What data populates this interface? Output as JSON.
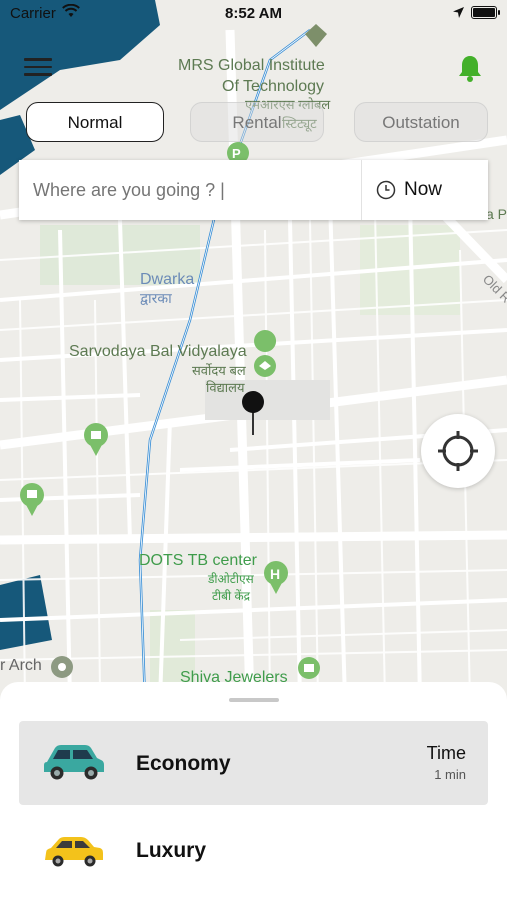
{
  "status_bar": {
    "carrier": "Carrier",
    "time": "8:52 AM"
  },
  "map": {
    "labels": {
      "mrs_1": "MRS Global Institute",
      "mrs_2": "Of Technology",
      "mrs_hindi_1": "एमआरएस ग्लोबल",
      "mrs_hindi_2": "स्टिट्यूट",
      "dwarka": "Dwarka",
      "dwarka_hindi": "द्वारका",
      "school": "Sarvodaya Bal Vidyalaya",
      "school_hindi_1": "सर्वोदय बल",
      "school_hindi_2": "विद्यालय",
      "dots": "DOTS TB center",
      "dots_hindi_1": "डीओटीएस",
      "dots_hindi_2": "टीबी केंद्र",
      "arch": "r Arch",
      "shiva": "Shiva Jewelers",
      "old": "Old R",
      "right_cut": "a P"
    }
  },
  "trip_types": {
    "normal": "Normal",
    "rental": "Rental",
    "outstation": "Outstation"
  },
  "search": {
    "placeholder": "Where are you going ? |",
    "when": "Now"
  },
  "rides": [
    {
      "name": "Economy",
      "time_label": "Time",
      "time_value": "1 min",
      "color": "#3aa8a0"
    },
    {
      "name": "Luxury",
      "color": "#f3c21b"
    }
  ],
  "colors": {
    "accent_green": "#43b02a",
    "poi_green": "#7bbf6a",
    "water": "#16587a",
    "route": "#3a8fd6"
  },
  "icons": {
    "menu": "hamburger-icon",
    "bell": "bell-icon",
    "clock": "clock-icon",
    "locate": "crosshair-icon",
    "pin": "map-pin-icon"
  }
}
